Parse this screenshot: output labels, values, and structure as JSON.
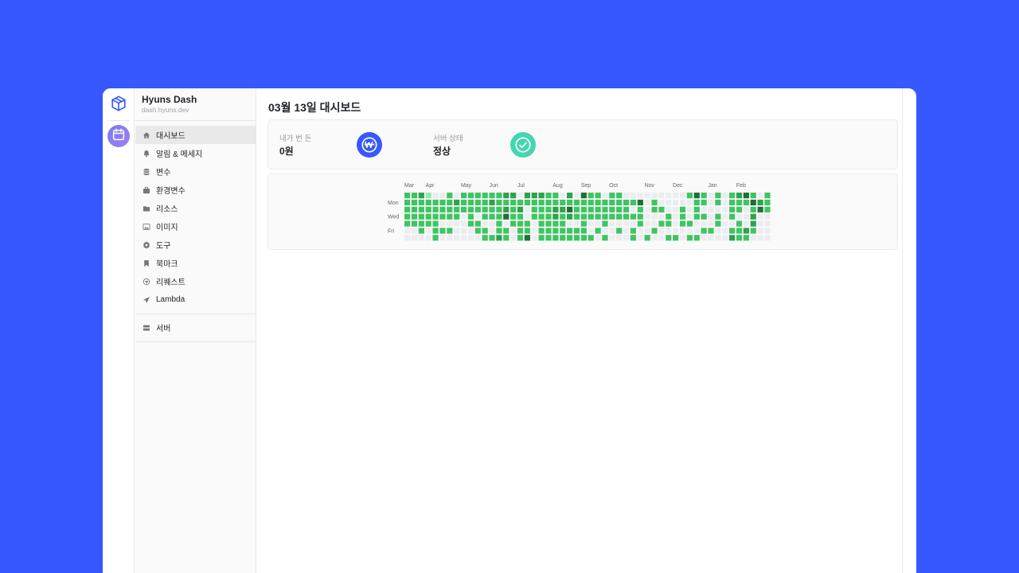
{
  "app": {
    "title": "Hyuns Dash",
    "subtitle": "dash.hyuns.dev"
  },
  "rail": {
    "items": [
      {
        "icon": "package-icon"
      },
      {
        "icon": "calendar-icon"
      }
    ]
  },
  "sidebar": {
    "items": [
      {
        "label": "대시보드",
        "icon": "home-icon",
        "active": true
      },
      {
        "label": "알림 & 메세지",
        "icon": "bell-icon"
      },
      {
        "label": "변수",
        "icon": "database-icon"
      },
      {
        "label": "환경변수",
        "icon": "briefcase-icon"
      },
      {
        "label": "리소스",
        "icon": "folder-icon"
      },
      {
        "label": "이미지",
        "icon": "image-icon"
      },
      {
        "label": "도구",
        "icon": "settings-icon"
      },
      {
        "label": "북마크",
        "icon": "bookmark-icon"
      },
      {
        "label": "리퀘스트",
        "icon": "globe-icon"
      },
      {
        "label": "Lambda",
        "icon": "send-icon"
      }
    ],
    "bottom_items": [
      {
        "label": "서버",
        "icon": "server-icon"
      }
    ]
  },
  "main": {
    "title": "03월 13일 대시보드",
    "stats": [
      {
        "label": "내가 번 돈",
        "value": "0원",
        "icon": "won-icon",
        "color": "#3658fe"
      },
      {
        "label": "서버 상태",
        "value": "정상",
        "icon": "check-icon",
        "color": "#45d6b0"
      }
    ]
  },
  "colors": {
    "background": "#3658fe",
    "levels": [
      "#ebedf0",
      "#9be9a8",
      "#40c463",
      "#30a14e",
      "#216e39"
    ]
  },
  "chart_data": {
    "type": "heatmap",
    "month_labels": [
      "Mar",
      "Apr",
      "May",
      "Jun",
      "Jul",
      "Aug",
      "Sep",
      "Oct",
      "Nov",
      "Dec",
      "Jan",
      "Feb"
    ],
    "month_label_weeks": [
      0,
      3,
      8,
      12,
      16,
      21,
      25,
      29,
      34,
      38,
      43,
      47
    ],
    "day_labels": [
      "",
      "Mon",
      "",
      "Wed",
      "",
      "Fri",
      ""
    ],
    "levels": [
      [
        2,
        2,
        3,
        1,
        0,
        0,
        2,
        0,
        2,
        2,
        2,
        2,
        2,
        2,
        3,
        3,
        0,
        3,
        3,
        3,
        2,
        2,
        0,
        3,
        0,
        4,
        2,
        2,
        0,
        2,
        2,
        0,
        0,
        0,
        0,
        0,
        0,
        0,
        0,
        0,
        2,
        4,
        2,
        0,
        2,
        0,
        2,
        3,
        4,
        2,
        0,
        2
      ],
      [
        2,
        2,
        2,
        2,
        2,
        2,
        2,
        3,
        2,
        2,
        2,
        2,
        3,
        2,
        2,
        2,
        2,
        2,
        2,
        2,
        2,
        2,
        2,
        2,
        2,
        2,
        2,
        2,
        2,
        2,
        2,
        2,
        2,
        4,
        0,
        2,
        0,
        0,
        0,
        0,
        0,
        2,
        2,
        0,
        2,
        0,
        2,
        2,
        2,
        4,
        3,
        2
      ],
      [
        2,
        2,
        2,
        2,
        2,
        2,
        2,
        2,
        2,
        2,
        2,
        2,
        2,
        2,
        3,
        2,
        3,
        0,
        2,
        2,
        2,
        3,
        3,
        4,
        2,
        2,
        2,
        2,
        2,
        2,
        2,
        2,
        0,
        2,
        0,
        2,
        2,
        0,
        0,
        2,
        0,
        2,
        0,
        0,
        0,
        0,
        2,
        2,
        0,
        2,
        4,
        2
      ],
      [
        2,
        2,
        2,
        2,
        2,
        2,
        2,
        2,
        0,
        2,
        0,
        2,
        2,
        2,
        4,
        2,
        2,
        0,
        2,
        2,
        2,
        3,
        2,
        3,
        2,
        2,
        2,
        2,
        2,
        2,
        2,
        2,
        2,
        2,
        0,
        0,
        0,
        2,
        0,
        2,
        0,
        2,
        2,
        0,
        2,
        0,
        2,
        0,
        0,
        3,
        0,
        0
      ],
      [
        2,
        2,
        2,
        2,
        2,
        0,
        0,
        0,
        0,
        2,
        2,
        0,
        0,
        2,
        0,
        2,
        2,
        2,
        0,
        2,
        2,
        2,
        2,
        0,
        0,
        2,
        0,
        0,
        2,
        0,
        0,
        0,
        0,
        2,
        0,
        0,
        2,
        2,
        0,
        2,
        2,
        0,
        0,
        0,
        2,
        0,
        0,
        2,
        0,
        3,
        0,
        0
      ],
      [
        0,
        0,
        2,
        0,
        2,
        2,
        2,
        0,
        0,
        0,
        2,
        2,
        0,
        2,
        2,
        0,
        2,
        2,
        0,
        2,
        2,
        2,
        2,
        2,
        2,
        2,
        0,
        2,
        0,
        0,
        2,
        0,
        2,
        0,
        0,
        2,
        0,
        0,
        0,
        0,
        0,
        0,
        2,
        2,
        0,
        0,
        2,
        2,
        3,
        2,
        0,
        0
      ],
      [
        0,
        0,
        0,
        0,
        2,
        0,
        0,
        0,
        0,
        0,
        0,
        2,
        2,
        3,
        2,
        0,
        2,
        4,
        0,
        2,
        2,
        2,
        2,
        2,
        2,
        2,
        2,
        0,
        2,
        0,
        0,
        0,
        2,
        0,
        2,
        0,
        0,
        2,
        2,
        0,
        2,
        2,
        0,
        0,
        0,
        0,
        3,
        2,
        2,
        0,
        0,
        0
      ]
    ]
  }
}
